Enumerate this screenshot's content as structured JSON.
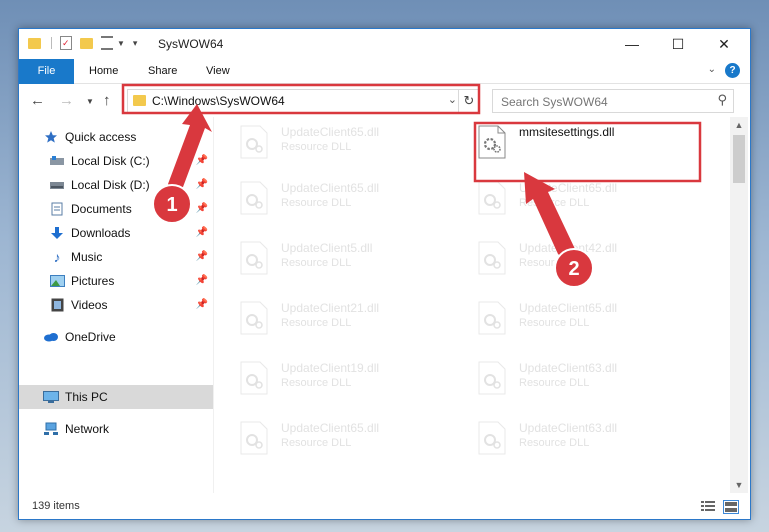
{
  "window": {
    "title": "SysWOW64",
    "minimize_glyph": "—",
    "maximize_glyph": "☐",
    "close_glyph": "✕"
  },
  "ribbon": {
    "tabs": [
      "File",
      "Home",
      "Share",
      "View"
    ],
    "help": "?"
  },
  "nav": {
    "address": "C:\\Windows\\SysWOW64",
    "search_placeholder": "Search SysWOW64"
  },
  "sidebar": {
    "items": [
      {
        "label": "Quick access",
        "icon": "star-icon"
      },
      {
        "label": "Local Disk (C:)",
        "icon": "drive-icon",
        "pinned": true
      },
      {
        "label": "Local Disk (D:)",
        "icon": "drive-icon",
        "pinned": true
      },
      {
        "label": "Documents",
        "icon": "documents-icon",
        "pinned": true
      },
      {
        "label": "Downloads",
        "icon": "downloads-icon",
        "pinned": true
      },
      {
        "label": "Music",
        "icon": "music-icon",
        "pinned": true
      },
      {
        "label": "Pictures",
        "icon": "pictures-icon",
        "pinned": true
      },
      {
        "label": "Videos",
        "icon": "videos-icon",
        "pinned": true
      },
      {
        "label": "OneDrive",
        "icon": "cloud-icon"
      },
      {
        "label": "This PC",
        "icon": "computer-icon",
        "selected": true
      },
      {
        "label": "Network",
        "icon": "network-icon"
      }
    ]
  },
  "files": {
    "left": [
      {
        "name": "UpdateClient65.dll",
        "type": "Resource DLL"
      },
      {
        "name": "UpdateClient65.dll",
        "type": "Resource DLL"
      },
      {
        "name": "UpdateClient5.dll",
        "type": "Resource DLL"
      },
      {
        "name": "UpdateClient21.dll",
        "type": "Resource DLL"
      },
      {
        "name": "UpdateClient19.dll",
        "type": "Resource DLL"
      },
      {
        "name": "UpdateClient65.dll",
        "type": "Resource DLL"
      }
    ],
    "right": [
      {
        "name": "mmsitesettings.dll",
        "type": "",
        "highlighted": true
      },
      {
        "name": "UpdateClient65.dll",
        "type": "Resource DLL"
      },
      {
        "name": "UpdateClient42.dll",
        "type": "Resource DLL"
      },
      {
        "name": "UpdateClient65.dll",
        "type": "Resource DLL"
      },
      {
        "name": "UpdateClient63.dll",
        "type": "Resource DLL"
      },
      {
        "name": "UpdateClient63.dll",
        "type": "Resource DLL"
      }
    ]
  },
  "status": {
    "item_count": "139 items"
  },
  "annotations": {
    "step1": "1",
    "step2": "2",
    "highlight_color": "#d9383e"
  }
}
